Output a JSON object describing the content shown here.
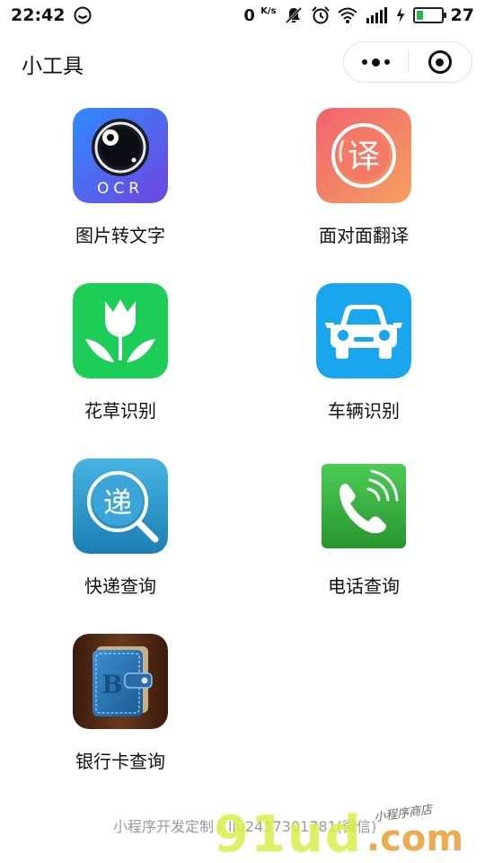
{
  "statusbar": {
    "time": "22:42",
    "net_speed": "0",
    "net_unit": "K/s",
    "battery_level": "27",
    "battery_fraction": 0.27,
    "icons": [
      "wechat-status-icon",
      "mute-icon",
      "alarm-icon",
      "wifi-icon",
      "signal-4g-icon",
      "charging-icon",
      "battery-icon"
    ]
  },
  "navbar": {
    "title": "小工具",
    "menu_icon": "more-dots-icon",
    "close_icon": "miniprogram-close-icon"
  },
  "tools": [
    {
      "label": "图片转文字",
      "icon": "ocr-camera-icon",
      "icon_text": "OCR",
      "colors": [
        "#3a86ff",
        "#6a4fe0"
      ]
    },
    {
      "label": "面对面翻译",
      "icon": "translate-icon",
      "icon_text": "译",
      "colors": [
        "#f46a6a",
        "#f39b5e"
      ]
    },
    {
      "label": "花草识别",
      "icon": "flower-icon",
      "colors": [
        "#1fcf5a",
        "#17b84d"
      ]
    },
    {
      "label": "车辆识别",
      "icon": "car-icon",
      "colors": [
        "#1ea7ef",
        "#1896e0"
      ]
    },
    {
      "label": "快递查询",
      "icon": "express-search-icon",
      "icon_text": "递",
      "colors": [
        "#3da9d8",
        "#1f84b8"
      ]
    },
    {
      "label": "电话查询",
      "icon": "phone-icon",
      "colors": [
        "#3fba4a",
        "#2b9b36"
      ]
    },
    {
      "label": "银行卡查询",
      "icon": "bank-wallet-icon",
      "icon_text": "B",
      "colors": [
        "#4a2614",
        "#2e78b8"
      ]
    }
  ],
  "footer": {
    "text": "小程序开发定制 - liu2417301781(微信)",
    "watermark_logo": "91ud",
    "watermark_domain": ".com",
    "watermark_tag": "小程序商店"
  }
}
